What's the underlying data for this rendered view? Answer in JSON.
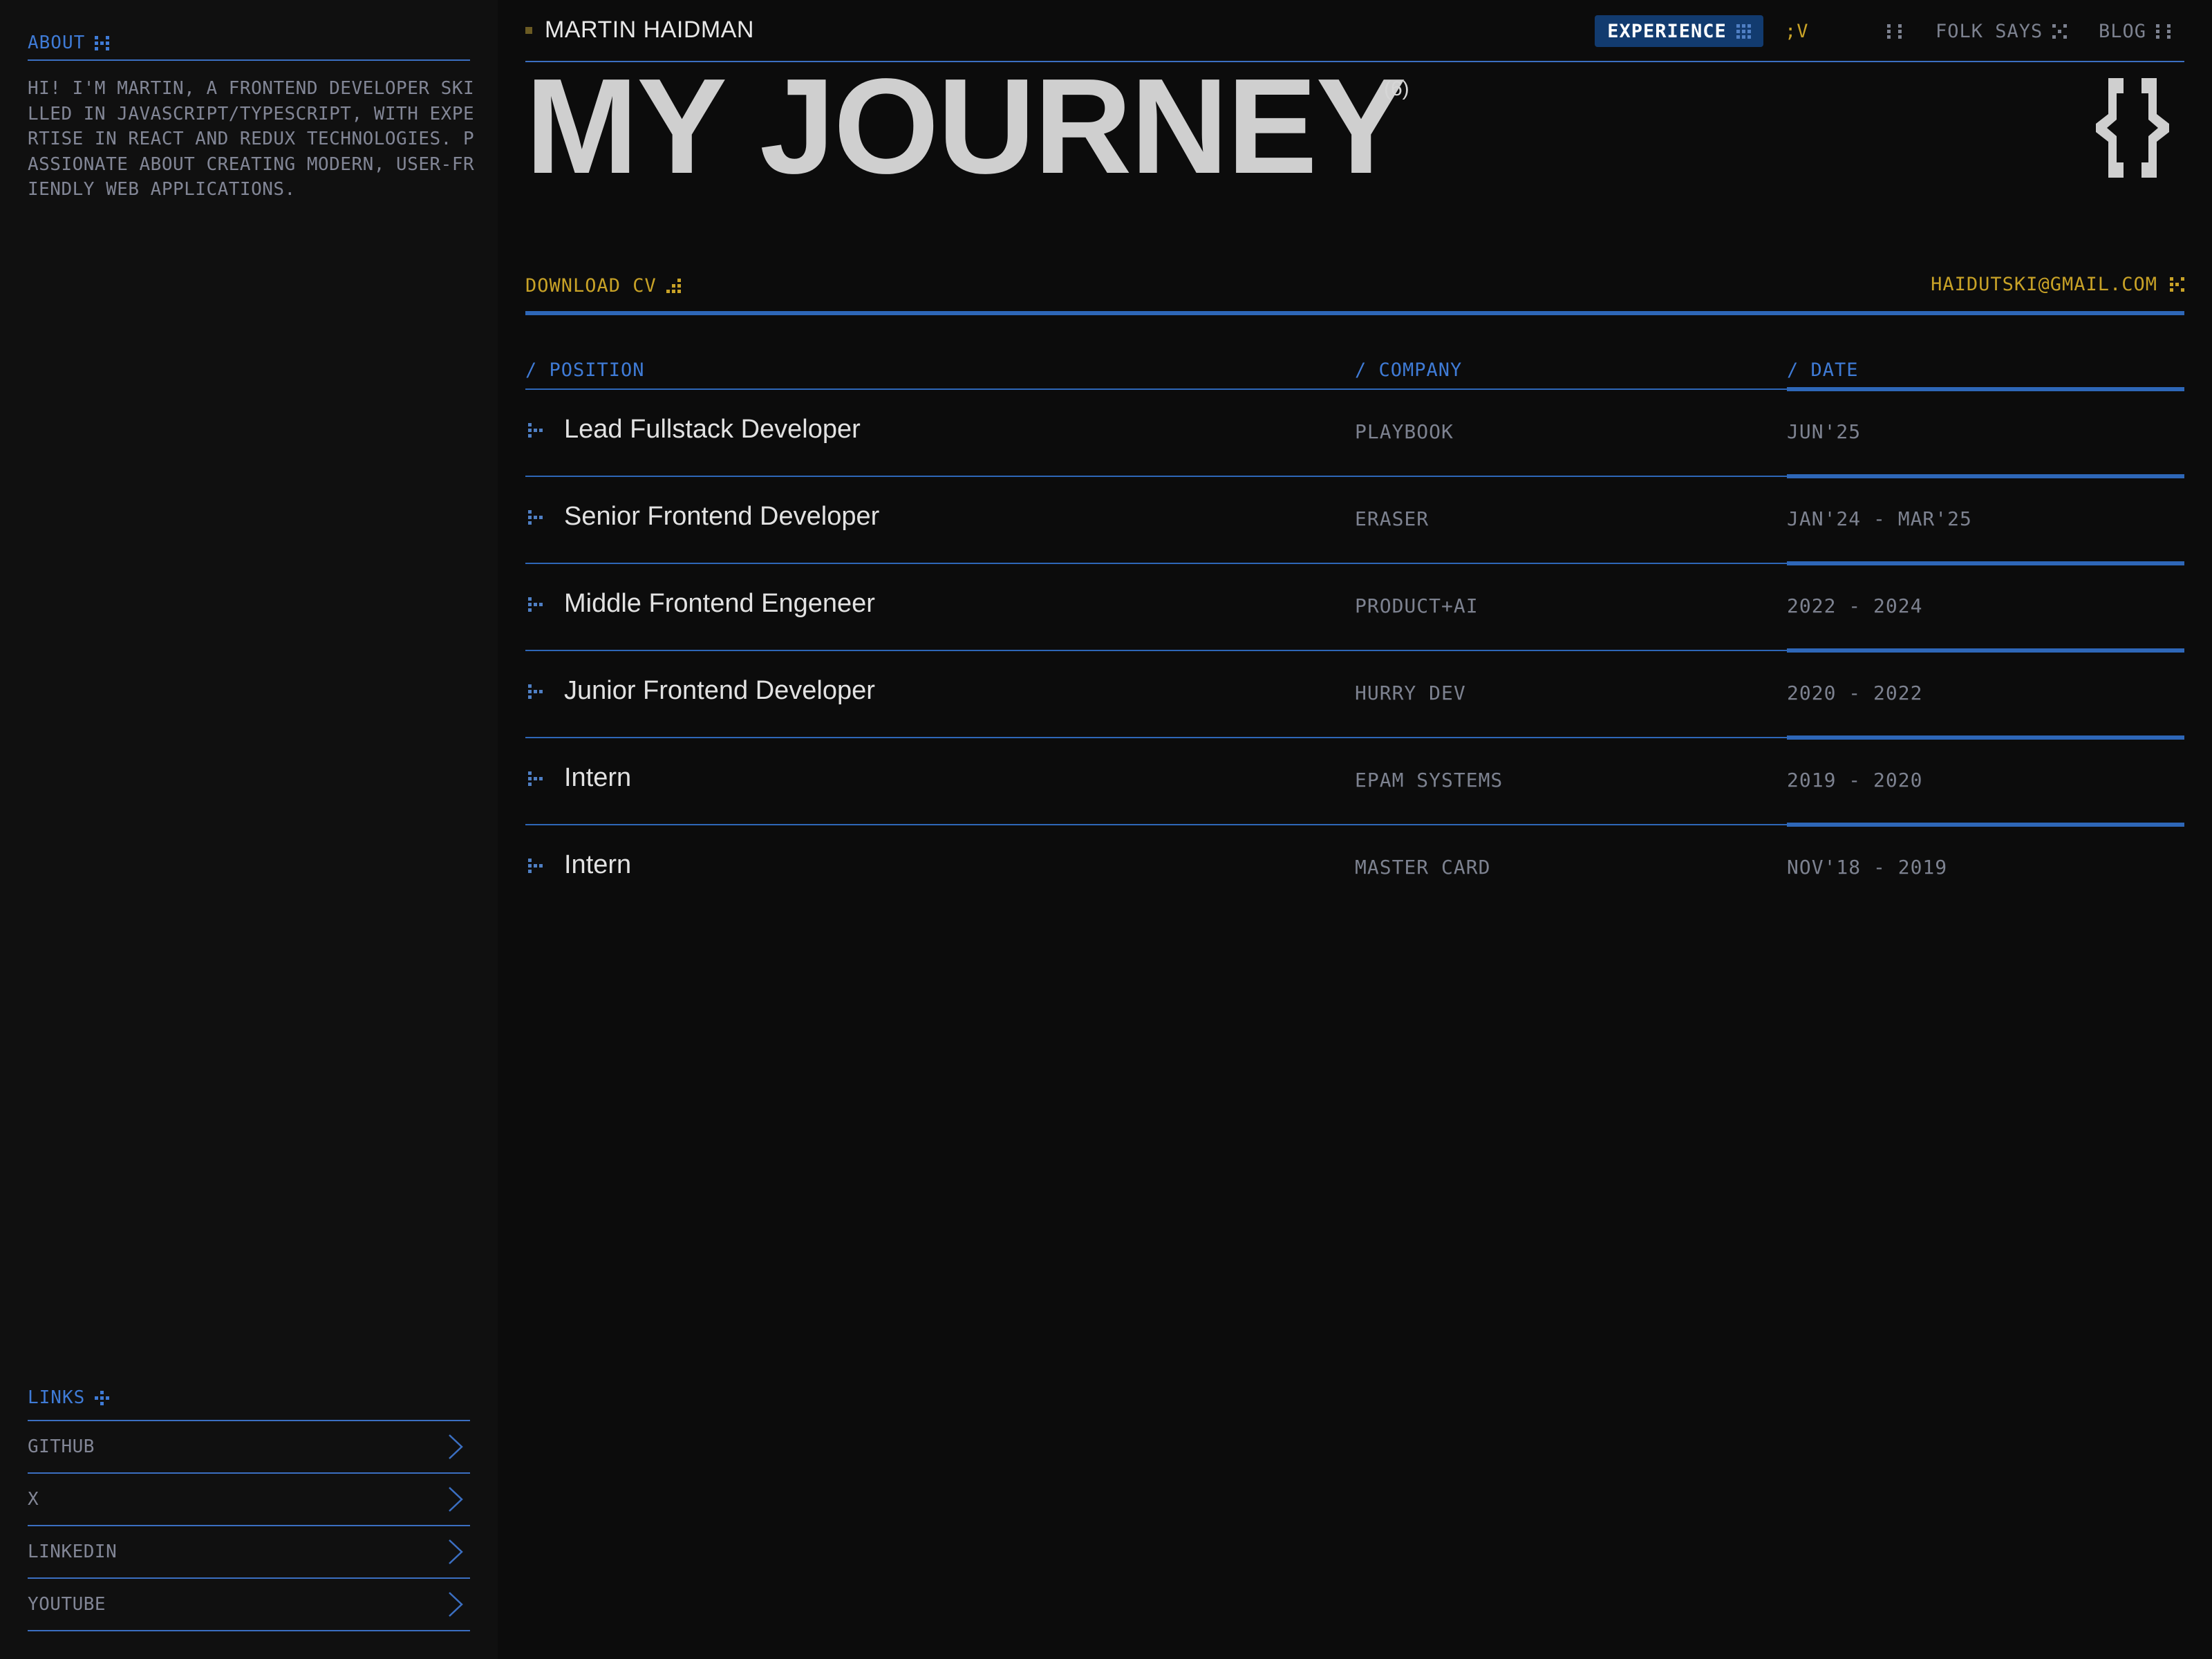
{
  "sidebar": {
    "about_heading": "ABOUT",
    "about_text": "HI! I'M MARTIN, A FRONTEND DEVELOPER SKILLED IN JAVASCRIPT/TYPESCRIPT, WITH EXPERTISE IN REACT AND REDUX TECHNOLOGIES. PASSIONATE ABOUT CREATING MODERN, USER-FRIENDLY WEB APPLICATIONS.",
    "links_heading": "LINKS",
    "links": [
      {
        "label": "GITHUB"
      },
      {
        "label": "X"
      },
      {
        "label": "LINKEDIN"
      },
      {
        "label": "YOUTUBE"
      }
    ]
  },
  "header": {
    "brand": "MARTIN HAIDMAN",
    "nav": {
      "experience": "EXPERIENCE",
      "lang": ";V",
      "folk_says": "FOLK SAYS",
      "blog": "BLOG"
    }
  },
  "hero": {
    "title": "MY JOURNEY",
    "count": "(6)"
  },
  "actions": {
    "download_cv": "DOWNLOAD CV",
    "email": "HAIDUTSKI@GMAIL.COM"
  },
  "table": {
    "headers": {
      "position": "/ POSITION",
      "company": "/ COMPANY",
      "date": "/ DATE"
    },
    "rows": [
      {
        "position": "Lead Fullstack Developer",
        "company": "PLAYBOOK",
        "date": "JUN'25"
      },
      {
        "position": "Senior Frontend Developer",
        "company": "ERASER",
        "date": "JAN'24 - MAR'25"
      },
      {
        "position": "Middle Frontend Engeneer",
        "company": "PRODUCT+AI",
        "date": "2022 - 2024"
      },
      {
        "position": "Junior Frontend Developer",
        "company": "HURRY DEV",
        "date": "2020 - 2022"
      },
      {
        "position": "Intern",
        "company": "EPAM SYSTEMS",
        "date": "2019 - 2020"
      },
      {
        "position": "Intern",
        "company": "MASTER CARD",
        "date": "NOV'18 - 2019"
      }
    ]
  },
  "colors": {
    "background": "#0c0c0c",
    "sidebar": "#101010",
    "accent_blue": "#2e67b8",
    "accent_gold": "#c8a227",
    "active_nav": "#123b6f"
  },
  "icons": {
    "section": "dots-grid-icon",
    "row": "dots-arrow-icon",
    "link": "chevron-right-icon",
    "logo": "curly-braces-icon"
  }
}
